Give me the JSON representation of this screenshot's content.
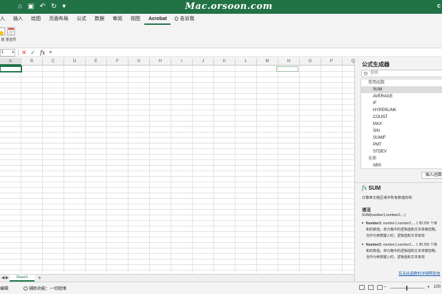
{
  "titlebar": {
    "watermark": "Mac.orsoon.com",
    "right_glyph": "c"
  },
  "ribbon_tabs": [
    "入",
    "插入",
    "绘图",
    "页面布局",
    "公式",
    "数据",
    "审阅",
    "视图",
    "Acrobat",
    "告诉我"
  ],
  "active_tab": "Acrobat",
  "ribbon_buttons": [
    {
      "label": "建"
    },
    {
      "label": "更选项"
    }
  ],
  "formula_bar": {
    "name_box": "1",
    "input": "="
  },
  "grid": {
    "columns": [
      "A",
      "B",
      "C",
      "D",
      "E",
      "F",
      "G",
      "H",
      "I",
      "J",
      "K",
      "L",
      "M",
      "N",
      "O",
      "P",
      "Q"
    ],
    "active_column": "A"
  },
  "sheets": [
    "Sheet1"
  ],
  "status": {
    "mode": "编辑",
    "accessibility": "辅助功能：一切就绪",
    "zoom": "100"
  },
  "formula_builder": {
    "title": "公式生成器",
    "search_placeholder": "搜索",
    "groups": [
      {
        "name": "常用函数",
        "items": [
          "SUM",
          "AVERAGE",
          "IF",
          "HYPERLINK",
          "COUNT",
          "MAX",
          "SIN",
          "SUMIF",
          "PMT",
          "STDEV"
        ]
      },
      {
        "name": "全部",
        "items": [
          "ABS"
        ]
      }
    ],
    "selected": "SUM",
    "insert_button": "插入函数",
    "fx_symbol": "fx",
    "function_name": "SUM",
    "description": "计算单元格区域中所有数值的和",
    "syntax_title": "语法",
    "syntax": "SUM(number1,number2,...)",
    "args": [
      {
        "name": "Number1:",
        "lines": [
          "number1,number2,... 1 到 255 个待",
          "和的数值。单元格中的逻辑值和文本将被忽略。",
          "当作为参数键入时，逻辑值和文本有效"
        ]
      },
      {
        "name": "Number2:",
        "lines": [
          "number1,number2,... 1 到 255 个待",
          "和的数值。单元格中的逻辑值和文本将被忽略。",
          "当作为参数键入时，逻辑值和文本有效"
        ]
      }
    ],
    "help_link": "有关此函数的详细帮助信"
  }
}
